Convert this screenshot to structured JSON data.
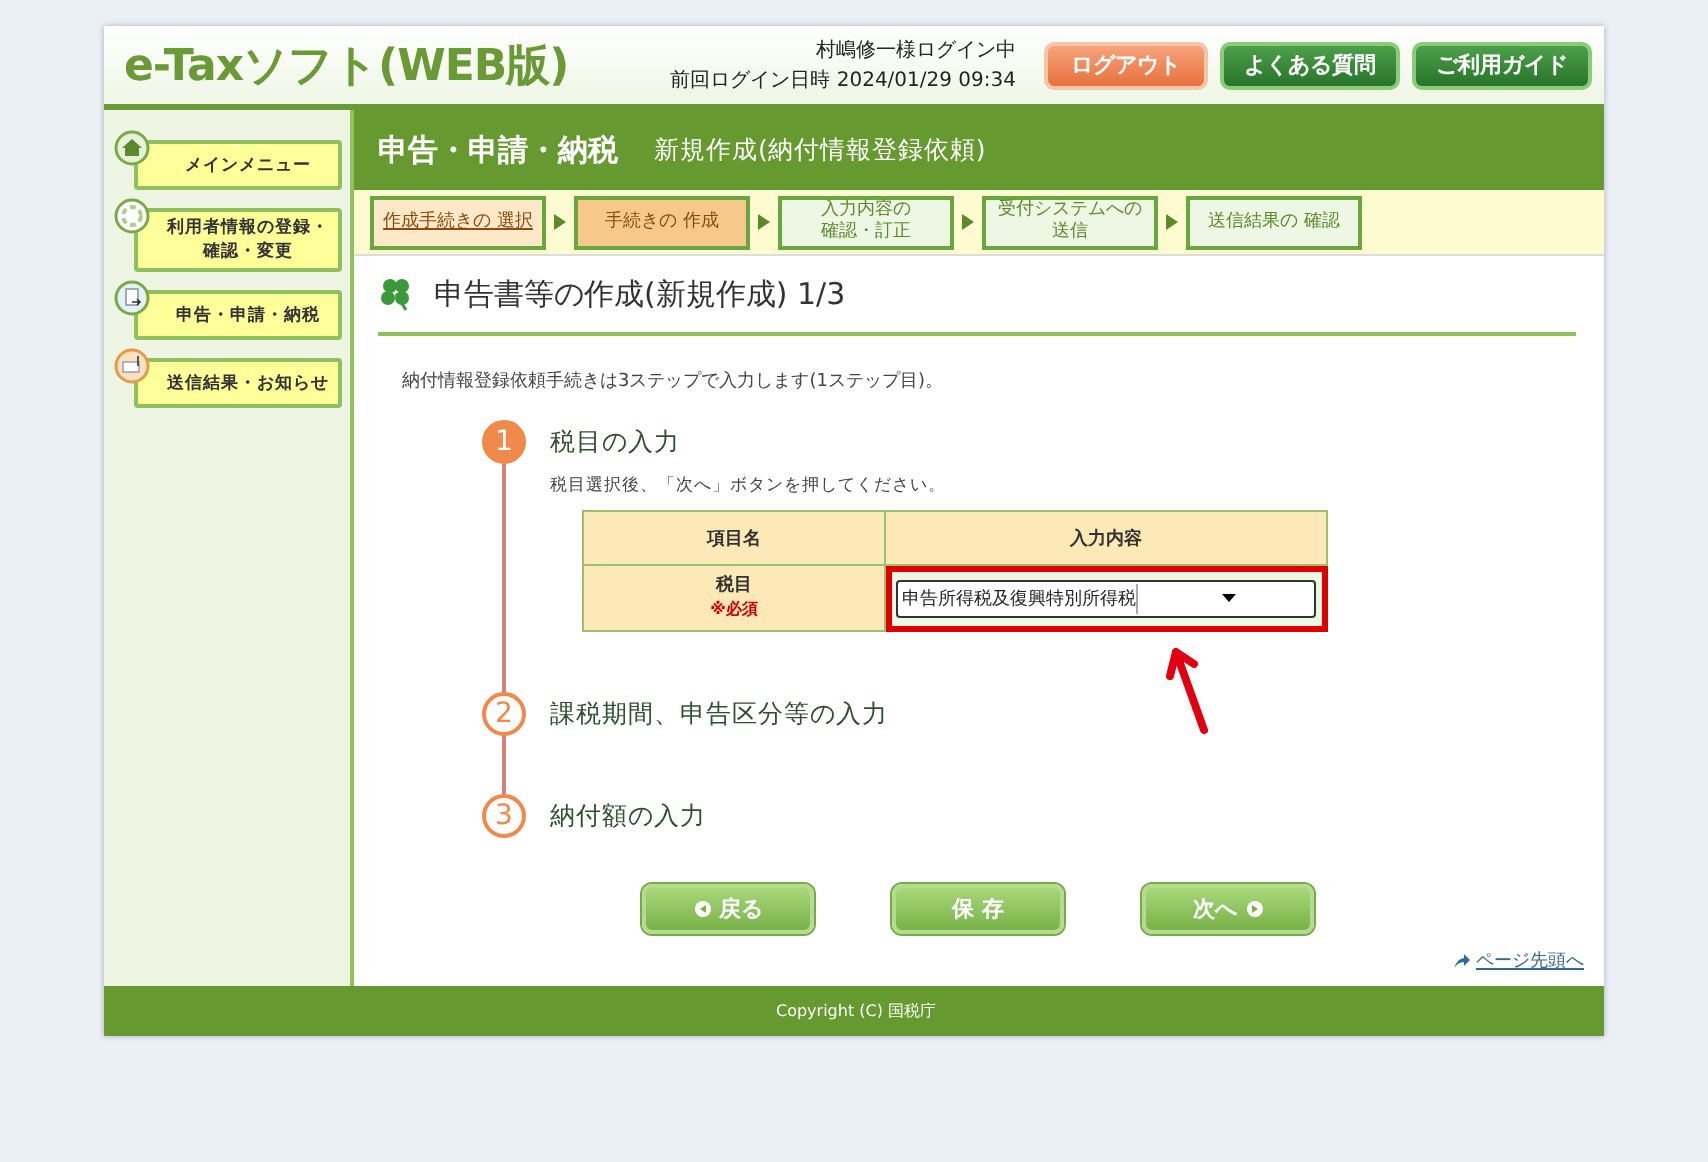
{
  "header": {
    "logo": "e-Taxソフト(WEB版)",
    "user": "村嶋修一様ログイン中",
    "last_login_label": "前回ログイン日時",
    "last_login": "2024/01/29 09:34",
    "buttons": [
      {
        "label": "ログアウト",
        "kind": "logout"
      },
      {
        "label": "よくある質問",
        "kind": "nav"
      },
      {
        "label": "ご利用ガイド",
        "kind": "nav"
      }
    ]
  },
  "sidebar": {
    "items": [
      {
        "label": "メインメニュー",
        "kind": "home"
      },
      {
        "lines": [
          "利用者情報の登録・",
          "確認・変更"
        ],
        "kind": "user"
      },
      {
        "label": "申告・申請・納税",
        "kind": "file"
      },
      {
        "label": "送信結果・お知らせ",
        "kind": "mail"
      }
    ]
  },
  "section": {
    "title": "申告・申請・納税",
    "subtitle": "新規作成(納付情報登録依頼)"
  },
  "steps": [
    {
      "label": "作成手続きの 選択",
      "selected": false,
      "link": true
    },
    {
      "label": "手続きの 作成",
      "selected": true,
      "link": false
    },
    {
      "lines": [
        "入力内容の",
        "確認・訂正"
      ],
      "selected": false,
      "link": false
    },
    {
      "lines": [
        "受付システムへの",
        "送信"
      ],
      "selected": false,
      "link": false
    },
    {
      "label": "送信結果の 確認",
      "selected": false,
      "link": false
    }
  ],
  "heading": "申告書等の作成(新規作成) 1/3",
  "intro": "納付情報登録依頼手続きは3ステップで入力します(1ステップ目)。",
  "input_steps": [
    {
      "number": "1",
      "title": "税目の入力",
      "selected": true,
      "hint": "税目選択後、「次へ」ボタンを押してください。",
      "table": {
        "columns": [
          "項目名",
          "入力内容"
        ],
        "rows": [
          {
            "label": "税目",
            "required": "※必須",
            "value": "申告所得税及復興特別所得税",
            "highlighted": true
          }
        ]
      }
    },
    {
      "number": "2",
      "title": "課税期間、申告区分等の入力",
      "selected": false
    },
    {
      "number": "3",
      "title": "納付額の入力",
      "selected": false
    }
  ],
  "actions": [
    {
      "label": "戻る",
      "kind": "back"
    },
    {
      "label": "保 存",
      "kind": "save"
    },
    {
      "label": "次へ",
      "kind": "next"
    }
  ],
  "page_top_link": "ページ先頭へ",
  "footer": "Copyright (C) 国税庁"
}
